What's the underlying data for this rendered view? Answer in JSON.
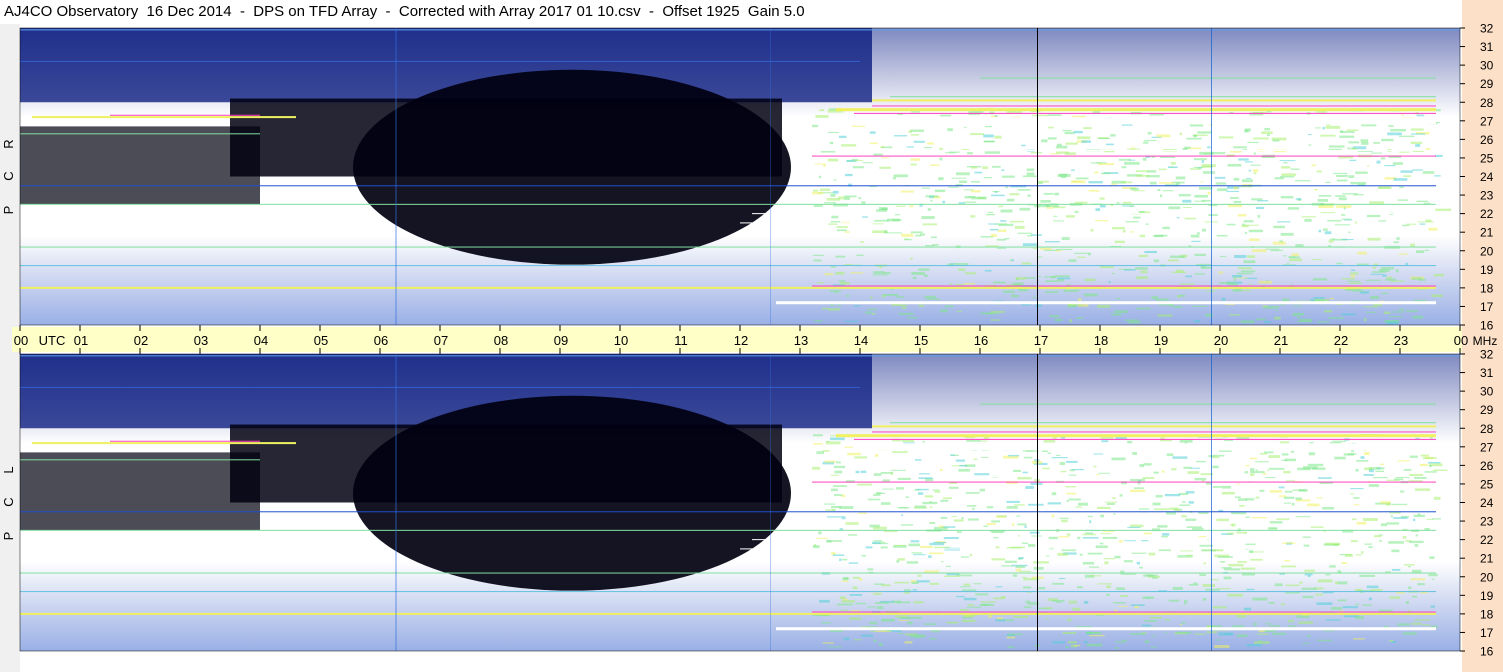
{
  "title": "AJ4CO Observatory  16 Dec 2014  -  DPS on TFD Array  -  Corrected with Array 2017 01 10.csv  -  Offset 1925  Gain 5.0",
  "panels": [
    {
      "letters": [
        "R",
        "C",
        "P"
      ]
    },
    {
      "letters": [
        "L",
        "C",
        "P"
      ]
    }
  ],
  "time_unit": "UTC",
  "freq_unit": "MHz",
  "chart_data": {
    "type": "heatmap",
    "title": "AJ4CO Observatory  16 Dec 2014  -  DPS on TFD Array  -  Corrected with Array 2017 01 10.csv  -  Offset 1925  Gain 5.0",
    "x_tick_labels": [
      "00",
      "01",
      "02",
      "03",
      "04",
      "05",
      "06",
      "07",
      "08",
      "09",
      "10",
      "11",
      "12",
      "13",
      "14",
      "15",
      "16",
      "17",
      "18",
      "19",
      "20",
      "21",
      "22",
      "23",
      "00"
    ],
    "y_tick_labels": [
      "16",
      "17",
      "18",
      "19",
      "20",
      "21",
      "22",
      "23",
      "24",
      "25",
      "26",
      "27",
      "28",
      "29",
      "30",
      "31",
      "32"
    ],
    "xlim": [
      0,
      24
    ],
    "ylim": [
      16,
      32
    ],
    "series": [
      {
        "name": "RCP"
      },
      {
        "name": "LCP"
      }
    ],
    "colors": {
      "dark": "#000010",
      "night": "#00127a",
      "blue": "#0a3cc8",
      "cyan": "#1ea0f0",
      "green": "#8ef07a",
      "yellow": "#f0f060",
      "magenta": "#ff40c0",
      "white": "#ffffff"
    }
  }
}
